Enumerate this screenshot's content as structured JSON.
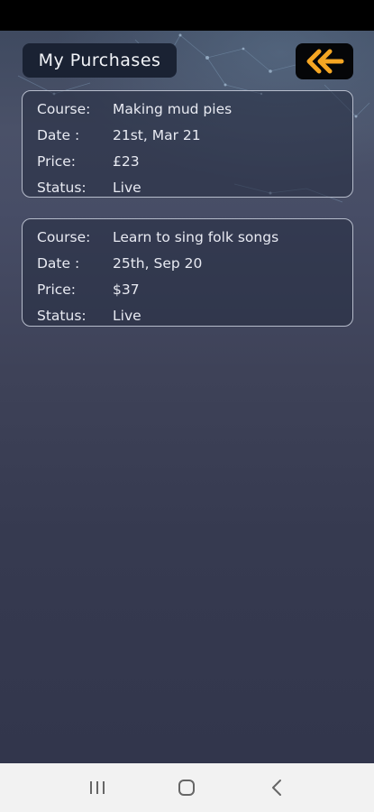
{
  "header": {
    "title": "My Purchases",
    "back_icon": "double-chevron-left-icon",
    "back_icon_color": "#f5a623"
  },
  "purchases": [
    {
      "course_label": "Course:",
      "course": "Making mud pies",
      "date_label": "Date :",
      "date": "21st, Mar 21",
      "price_label": "Price:",
      "price": "£23",
      "status_label": "Status:",
      "status": "Live"
    },
    {
      "course_label": "Course:",
      "course": "Learn to sing folk songs",
      "date_label": "Date :",
      "date": "25th, Sep 20",
      "price_label": "Price:",
      "price": "$37",
      "status_label": "Status:",
      "status": "Live"
    }
  ],
  "nav": {
    "recents_icon": "recents-icon",
    "home_icon": "home-icon",
    "back_icon": "back-icon"
  },
  "colors": {
    "accent": "#f5a623",
    "background": "#363a50",
    "card_border": "#b6bccb"
  }
}
